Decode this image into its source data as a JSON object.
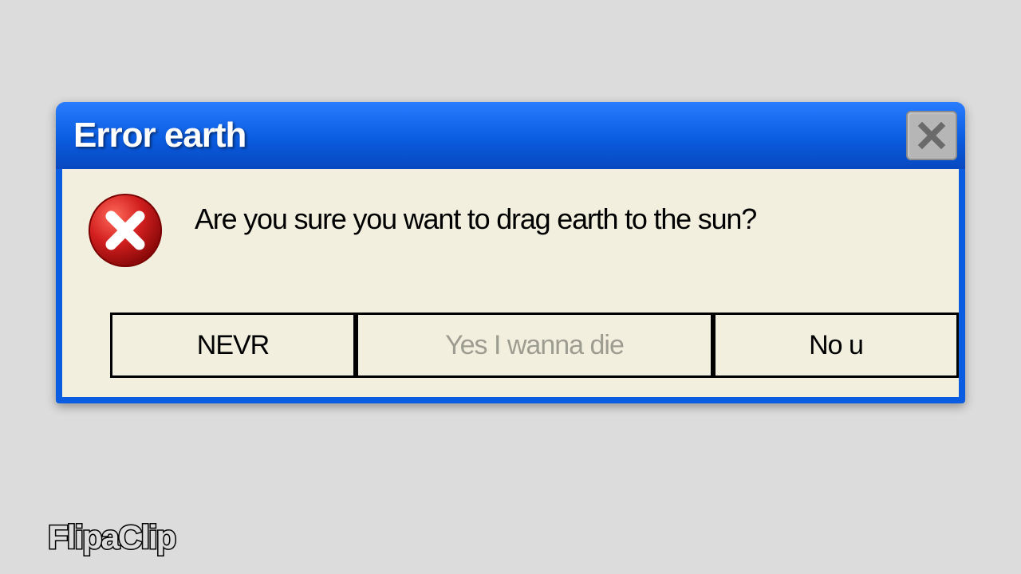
{
  "dialog": {
    "title": "Error earth",
    "message": "Are you sure you want to drag earth to the sun?",
    "buttons": {
      "nevr": "NEVR",
      "yes": "Yes I wanna die",
      "nou": "No u"
    }
  },
  "watermark": "FlipaClip",
  "colors": {
    "titlebar_blue": "#0a5ce0",
    "client_beige": "#f2efde",
    "error_red": "#d21f1f"
  }
}
